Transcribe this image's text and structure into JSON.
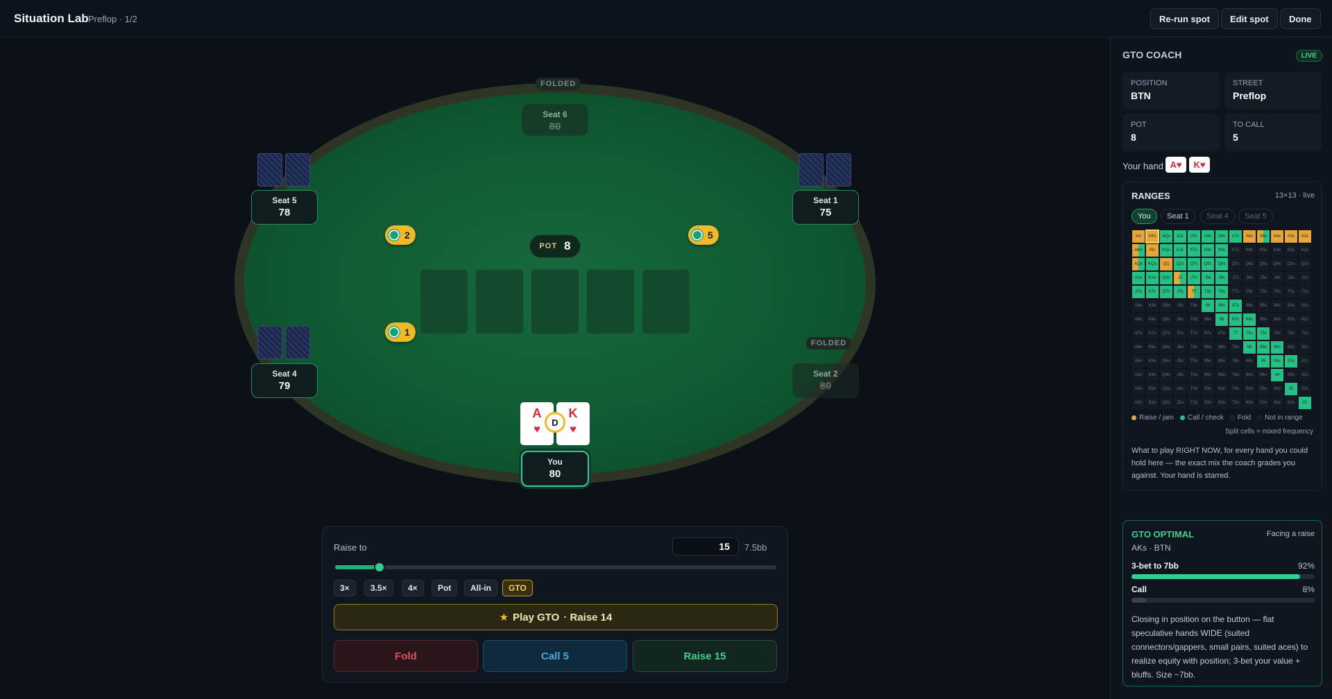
{
  "header": {
    "title": "Situation Lab",
    "subtitle": "Preflop · 1/2",
    "buttons": [
      "Re-run spot",
      "Edit spot",
      "Done"
    ]
  },
  "table": {
    "folded_label": "FOLDED",
    "seats": [
      {
        "name": "Seat 6",
        "stack": "80",
        "folded": true
      },
      {
        "name": "Seat 5",
        "stack": "78",
        "folded": false
      },
      {
        "name": "Seat 1",
        "stack": "75",
        "folded": false
      },
      {
        "name": "Seat 4",
        "stack": "79",
        "folded": false
      },
      {
        "name": "Seat 2",
        "stack": "80",
        "folded": true
      },
      {
        "name": "You",
        "stack": "80",
        "folded": false
      }
    ],
    "bets": {
      "seat5": "2",
      "seat1": "5",
      "seat4": "1"
    },
    "pot_label": "POT",
    "pot_value": "8",
    "dealer_label": "D",
    "hero_cards": [
      {
        "rank": "A",
        "suit": "♥"
      },
      {
        "rank": "K",
        "suit": "♥"
      }
    ]
  },
  "action_panel": {
    "raise_label": "Raise to",
    "raise_value": "15",
    "raise_bb": "7.5bb",
    "slider_fraction": 0.1,
    "presets": [
      "3×",
      "3.5×",
      "4×",
      "Pot",
      "All-in",
      "GTO"
    ],
    "play_gto_star": "★",
    "play_gto_label": "Play GTO",
    "play_gto_action": "· Raise 14",
    "fold_label": "Fold",
    "call_label": "Call 5",
    "raise_btn_label": "Raise 15"
  },
  "coach": {
    "title": "GTO COACH",
    "live_badge": "LIVE",
    "stats": [
      {
        "key": "POSITION",
        "value": "BTN"
      },
      {
        "key": "STREET",
        "value": "Preflop"
      },
      {
        "key": "POT",
        "value": "8"
      },
      {
        "key": "TO CALL",
        "value": "5"
      }
    ],
    "your_hand_label": "Your hand",
    "your_hand_cards": [
      "A♥",
      "K♥"
    ],
    "ranges": {
      "title": "RANGES",
      "subtitle": "13×13 · live",
      "tabs": [
        "You",
        "Seat 1",
        "Seat 4",
        "Seat 5"
      ],
      "legend": [
        "Raise / jam",
        "Call / check",
        "Fold",
        "Not in range"
      ],
      "split_note": "Split cells = mixed frequency",
      "description": "What to play RIGHT NOW, for every hand you could hold here — the exact mix the coach grades you against. Your hand is starred.",
      "ranks": [
        "A",
        "K",
        "Q",
        "J",
        "T",
        "9",
        "8",
        "7",
        "6",
        "5",
        "4",
        "3",
        "2"
      ],
      "grid_rows": [
        "r h c c c c c c r m r r r",
        "m r c c c c c f f f f f f",
        "m c r c c c c f f f f f f",
        "c c c m c c c f f f f f f",
        "c c c c m c c f f f f f f",
        "f f f f f c c c f f f f f",
        "f f f f f f c c c f f f f",
        "f f f f f f f c c c f f f",
        "f f f f f f f f c c c f f",
        "f f f f f f f f f c c c f",
        "f f f f f f f f f f c f f",
        "f f f f f f f f f f f c f",
        "f f f f f f f f f f f f c"
      ]
    },
    "optimal": {
      "title": "GTO OPTIMAL",
      "facing": "Facing a raise",
      "hand": "AKs · BTN",
      "actions": [
        {
          "name": "3-bet to 7bb",
          "percent": "92%",
          "freq": 0.92
        },
        {
          "name": "Call",
          "percent": "8%",
          "freq": 0.08
        }
      ],
      "description": "Closing in position on the button — flat speculative hands WIDE (suited connectors/gappers, small pairs, suited aces) to realize equity with position; 3-bet your value + bluffs. Size ~7bb."
    }
  },
  "colors": {
    "raise": "#e3a73b",
    "call": "#27c084",
    "accent": "#3fd08d",
    "felt": "#0f5a32",
    "chip": "#f1b827"
  }
}
